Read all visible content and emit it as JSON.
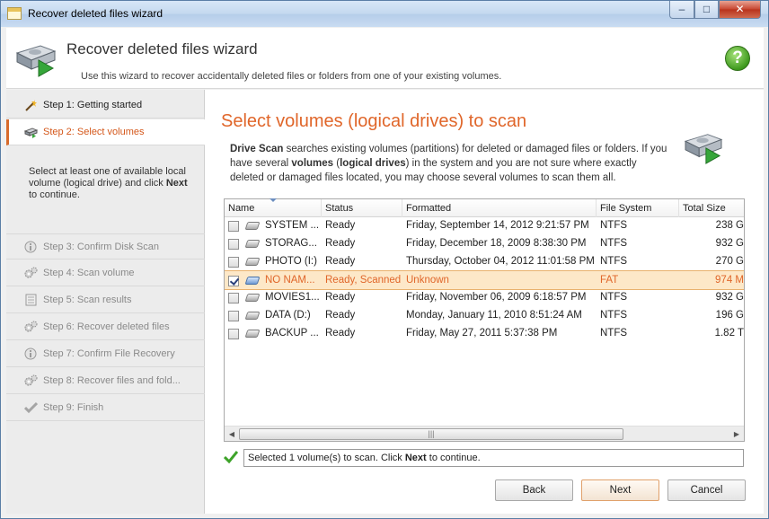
{
  "window": {
    "title": "Recover deleted files wizard"
  },
  "header": {
    "title": "Recover deleted files wizard",
    "subtitle": "Use this wizard to recover accidentally deleted files or folders from one of your existing volumes."
  },
  "steps": [
    {
      "label": "Step 1: Getting started",
      "state": "done",
      "icon": "wand-icon"
    },
    {
      "label": "Step 2: Select volumes",
      "state": "active",
      "icon": "drive-icon"
    },
    {
      "label": "Step 3: Confirm Disk Scan",
      "state": "future",
      "icon": "info-icon"
    },
    {
      "label": "Step 4: Scan volume",
      "state": "future",
      "icon": "gears-icon"
    },
    {
      "label": "Step 5: Scan results",
      "state": "future",
      "icon": "list-icon"
    },
    {
      "label": "Step 6: Recover deleted files",
      "state": "future",
      "icon": "gears-icon"
    },
    {
      "label": "Step 7: Confirm File Recovery",
      "state": "future",
      "icon": "info-icon"
    },
    {
      "label": "Step 8: Recover files and fold...",
      "state": "future",
      "icon": "gears-icon"
    },
    {
      "label": "Step 9: Finish",
      "state": "future",
      "icon": "check-icon"
    }
  ],
  "sidebar": {
    "desc_part1": "Select at least one of available local volume (logical drive) and click ",
    "desc_bold": "Next",
    "desc_part2": " to continue."
  },
  "main": {
    "title": "Select volumes (logical drives) to scan",
    "intro_b1": "Drive Scan",
    "intro_t1": " searches existing volumes (partitions) for deleted or damaged files or folders. If you have several ",
    "intro_b2": "volumes",
    "intro_t2": " (",
    "intro_b3": "logical drives",
    "intro_t3": ") in the system and you are not sure where exactly deleted or damaged files located, you may choose several volumes to scan them all."
  },
  "table": {
    "columns": [
      "Name",
      "Status",
      "Formatted",
      "File System",
      "Total Size"
    ],
    "rows": [
      {
        "name": "SYSTEM ...",
        "status": "Ready",
        "formatted": "Friday, September 14, 2012 9:21:57 PM",
        "fs": "NTFS",
        "size": "238 G",
        "checked": false,
        "selected": false
      },
      {
        "name": "STORAG...",
        "status": "Ready",
        "formatted": "Friday, December 18, 2009 8:38:30 PM",
        "fs": "NTFS",
        "size": "932 G",
        "checked": false,
        "selected": false
      },
      {
        "name": "PHOTO (I:)",
        "status": "Ready",
        "formatted": "Thursday, October 04, 2012 11:01:58 PM",
        "fs": "NTFS",
        "size": "270 G",
        "checked": false,
        "selected": false
      },
      {
        "name": "NO NAM...",
        "status": "Ready, Scanned",
        "formatted": "Unknown",
        "fs": "FAT",
        "size": "974 M",
        "checked": true,
        "selected": true
      },
      {
        "name": "MOVIES1...",
        "status": "Ready",
        "formatted": "Friday, November 06, 2009 6:18:57 PM",
        "fs": "NTFS",
        "size": "932 G",
        "checked": false,
        "selected": false
      },
      {
        "name": "DATA (D:)",
        "status": "Ready",
        "formatted": "Monday, January 11, 2010 8:51:24 AM",
        "fs": "NTFS",
        "size": "196 G",
        "checked": false,
        "selected": false
      },
      {
        "name": "BACKUP ...",
        "status": "Ready",
        "formatted": "Friday, May 27, 2011 5:37:38 PM",
        "fs": "NTFS",
        "size": "1.82 T",
        "checked": false,
        "selected": false
      }
    ]
  },
  "status": {
    "text1": "Selected 1 volume(s) to scan. Click ",
    "bold": "Next",
    "text2": " to continue."
  },
  "buttons": {
    "back": "Back",
    "next": "Next",
    "cancel": "Cancel"
  },
  "colors": {
    "accent": "#e0662a",
    "selection": "#fde8c8"
  }
}
